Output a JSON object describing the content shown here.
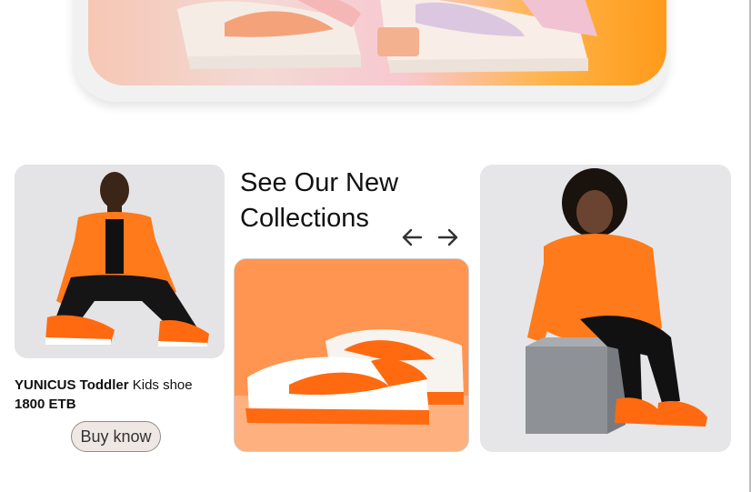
{
  "hero": {
    "image_name": "pink-orange-sneakers-hero"
  },
  "featured_product": {
    "name_bold": "YUNICUS Toddler",
    "name_rest": " Kids shoe",
    "price": "1800 ETB",
    "buy_label": "Buy know",
    "image_name": "model-orange-outfit-sneakers"
  },
  "section": {
    "title": "See Our New Collections",
    "prev_icon": "arrow-left-icon",
    "next_icon": "arrow-right-icon"
  },
  "collection_images": [
    {
      "name": "orange-white-sneaker"
    },
    {
      "name": "model-orange-hoodie-seated"
    }
  ],
  "colors": {
    "accent": "#ff7a1a",
    "button_bg": "#efe7e4"
  }
}
